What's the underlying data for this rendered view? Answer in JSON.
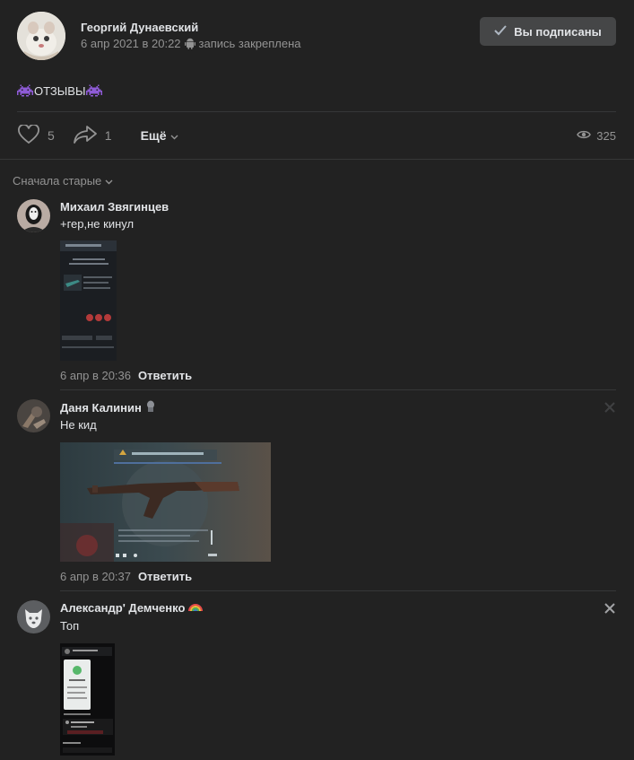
{
  "post": {
    "author": "Георгий Дунаевский",
    "date": "6 апр 2021 в 20:22",
    "pinned_label": "запись закреплена",
    "subscribe_label": "Вы подписаны",
    "text": "отзывы",
    "likes": "5",
    "shares": "1",
    "more_label": "Ещё",
    "views": "325"
  },
  "comments": {
    "sort_label": "Сначала старые",
    "items": [
      {
        "author": "Михаил Звягинцев",
        "text": "+гер,не кинул",
        "date": "6 апр в 20:36",
        "reply_label": "Ответить"
      },
      {
        "author": "Даня Калинин",
        "text": "Не кид",
        "date": "6 апр в 20:37",
        "reply_label": "Ответить"
      },
      {
        "author": "Александр' Демченко",
        "text": "Топ"
      }
    ]
  },
  "colors": {
    "background": "#222222",
    "text_primary": "#e1e3e6",
    "text_secondary": "#939393",
    "button_bg": "#454647",
    "divider": "#363738"
  },
  "icons": [
    "android-icon",
    "check-icon",
    "invader-icon",
    "heart-icon",
    "share-icon",
    "chevron-down-icon",
    "eye-icon",
    "close-icon",
    "sticker-icon",
    "rainbow-icon"
  ]
}
